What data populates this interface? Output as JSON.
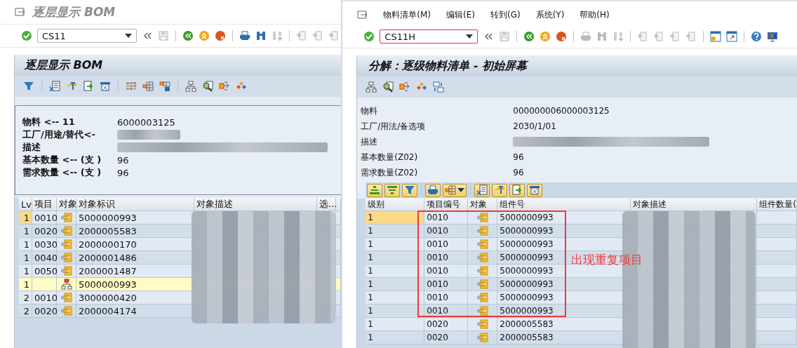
{
  "left": {
    "window_title": "逐层显示 BOM",
    "command_field": {
      "value": "CS11"
    },
    "panel_title": "逐层显示 BOM",
    "header_fields": [
      {
        "label": "物料 <-- 11",
        "value": "6000003125"
      },
      {
        "label": "工厂/用途/替代<-"
      },
      {
        "label": "描述"
      },
      {
        "label": "基本数量 <-- (支 )",
        "value": "96"
      },
      {
        "label": "需求数量 <-- (支 )",
        "value": "96"
      }
    ],
    "table": {
      "columns": [
        "Lv",
        "项目",
        "对象",
        "对象标识",
        "对象描述",
        "选..."
      ],
      "rows": [
        {
          "level": "1",
          "item": "0010",
          "kind": "material",
          "object_id": "5000000993",
          "selected": false,
          "focused": true
        },
        {
          "level": "1",
          "item": "0020",
          "kind": "material",
          "object_id": "2000005583",
          "selected": false,
          "focused": false
        },
        {
          "level": "1",
          "item": "0030",
          "kind": "material",
          "object_id": "2000000170",
          "selected": false,
          "focused": false
        },
        {
          "level": "1",
          "item": "0040",
          "kind": "material",
          "object_id": "2000001486",
          "selected": false,
          "focused": false
        },
        {
          "level": "1",
          "item": "0050",
          "kind": "material",
          "object_id": "2000001487",
          "selected": false,
          "focused": false
        },
        {
          "level": "1",
          "kind": "bom",
          "object_id": "5000000993",
          "selected": true,
          "focused": false
        },
        {
          "level": "2",
          "item": "0010",
          "kind": "material",
          "object_id": "3000000420",
          "selected": false,
          "focused": false
        },
        {
          "level": "2",
          "item": "0020",
          "kind": "material",
          "object_id": "2000004174",
          "selected": false,
          "focused": false
        }
      ]
    }
  },
  "right": {
    "menu": [
      "物料清单(M)",
      "编辑(E)",
      "转到(G)",
      "系统(Y)",
      "帮助(H)"
    ],
    "command_field": {
      "value": "CS11H",
      "focused": true
    },
    "panel_title": "分解：逐级物料清单 - 初始屏幕",
    "header_fields": [
      {
        "label": "物料",
        "value": "000000006000003125"
      },
      {
        "label": "工厂/用法/备选项",
        "value": "2030/1/01"
      },
      {
        "label": "描述"
      },
      {
        "label": "基本数量(Z02)",
        "value": "96"
      },
      {
        "label": "需求数量(Z02)",
        "value": "96"
      }
    ],
    "table": {
      "columns": [
        "级别",
        "项目编号",
        "对象",
        "组件号",
        "对象描述",
        "组件数量("
      ],
      "rows": [
        {
          "level": "1",
          "item": "0010",
          "kind": "material",
          "component": "5000000993",
          "focused": true
        },
        {
          "level": "1",
          "item": "0010",
          "kind": "material",
          "component": "5000000993",
          "focused": false
        },
        {
          "level": "1",
          "item": "0010",
          "kind": "material",
          "component": "5000000993",
          "focused": false
        },
        {
          "level": "1",
          "item": "0010",
          "kind": "material",
          "component": "5000000993",
          "focused": false
        },
        {
          "level": "1",
          "item": "0010",
          "kind": "material",
          "component": "5000000993",
          "focused": false
        },
        {
          "level": "1",
          "item": "0010",
          "kind": "material",
          "component": "5000000993",
          "focused": false
        },
        {
          "level": "1",
          "item": "0010",
          "kind": "material",
          "component": "5000000993",
          "focused": false
        },
        {
          "level": "1",
          "item": "0010",
          "kind": "material",
          "component": "5000000993",
          "focused": false
        },
        {
          "level": "1",
          "item": "0020",
          "kind": "material",
          "component": "2000005583",
          "focused": false
        },
        {
          "level": "1",
          "item": "0020",
          "kind": "material",
          "component": "2000005583",
          "focused": false
        }
      ]
    },
    "annotation": {
      "text": "出现重复项目"
    }
  }
}
